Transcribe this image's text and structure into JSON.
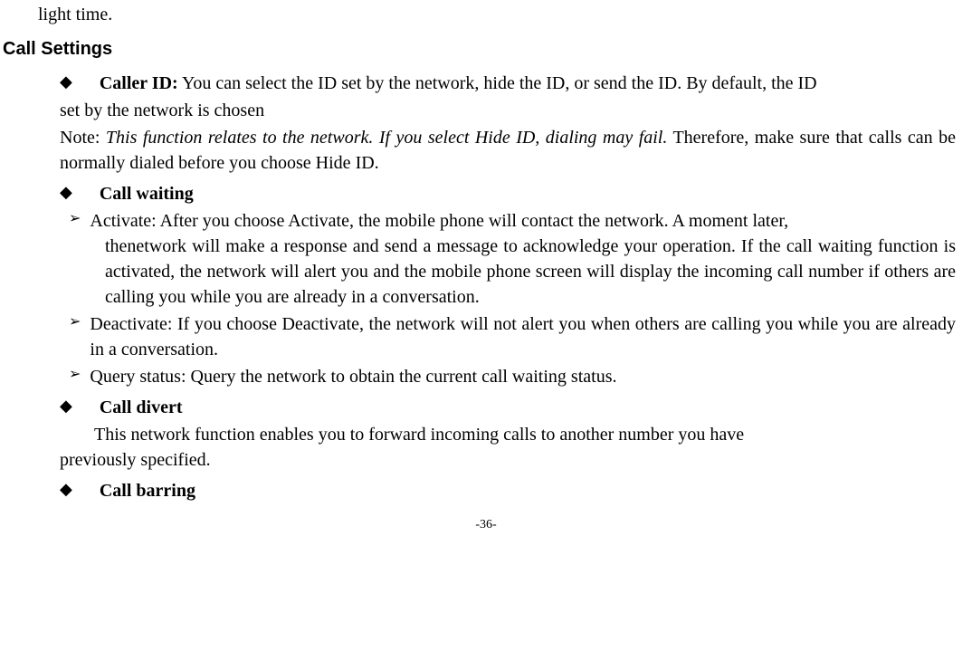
{
  "fragmentTop": "light time.",
  "heading": "Call Settings",
  "callerId": {
    "label": "Caller ID:",
    "text1": " You can select the ID set by the network, hide the ID, or send the ID. By default, the ID",
    "text2": "set by the network is chosen",
    "noteLabel": "Note: ",
    "noteItalic": "This function relates to the network. If you select Hide ID, dialing may fail.",
    "noteRest": " Therefore, make sure that calls can be normally dialed before you choose Hide ID."
  },
  "callWaiting": {
    "label": "Call waiting",
    "activate1": "Activate: After you choose Activate, the mobile phone will contact the network. A moment later,",
    "activate2": "thenetwork will make a response and send a message to acknowledge your operation. If the call waiting function is activated, the network will alert you and the mobile phone screen will display the incoming call number if others are calling you while you are already in a conversation.",
    "deactivate": "Deactivate: If you choose Deactivate, the network will not alert you when others are calling you while you are already in a conversation.",
    "query": "Query status: Query the network to obtain the current call waiting status."
  },
  "callDivert": {
    "label": "Call divert",
    "desc": "This network function enables you to forward incoming calls to another number you have previously specified."
  },
  "callBarring": {
    "label": "Call barring"
  },
  "pageNum": "-36-"
}
